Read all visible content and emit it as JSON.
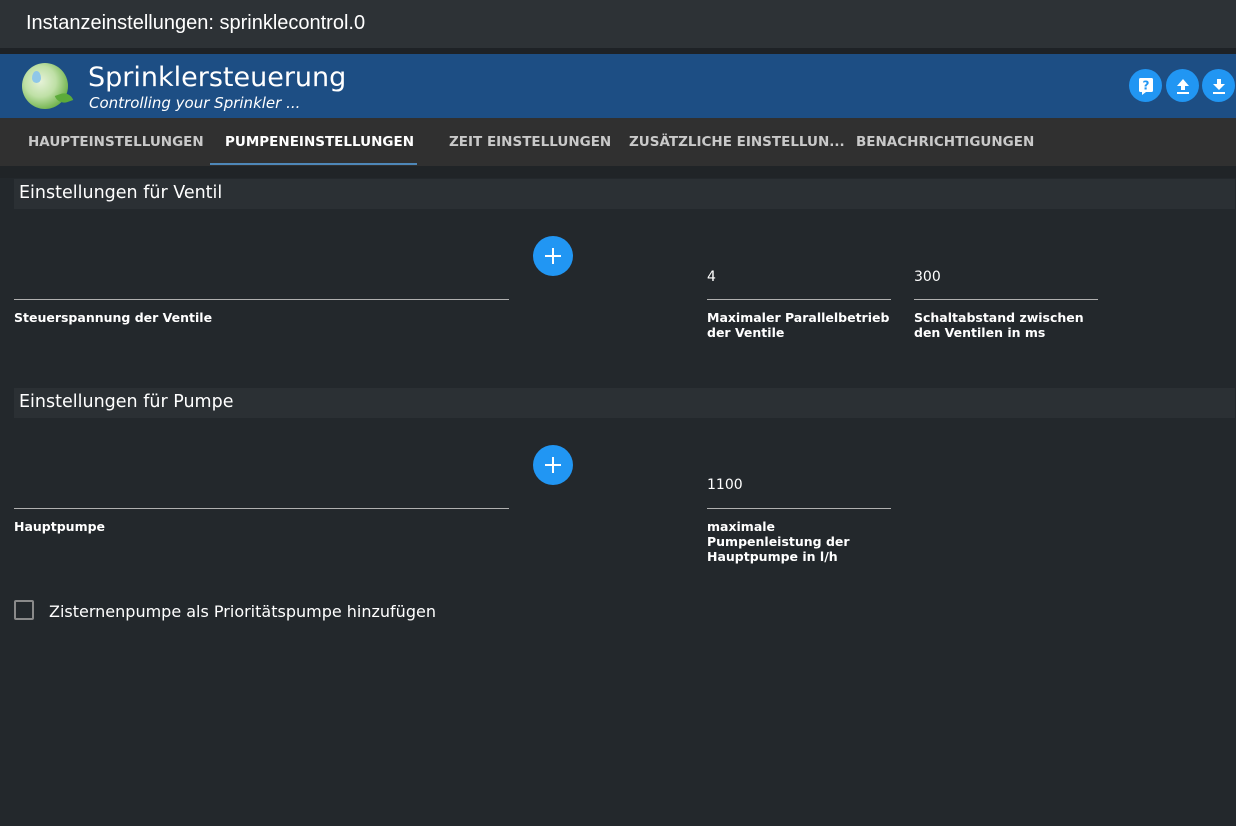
{
  "window": {
    "title": "Instanzeinstellungen: sprinklecontrol.0"
  },
  "banner": {
    "title": "Sprinklersteuerung",
    "subtitle": "Controlling your Sprinkler ...",
    "accent": "#1d4e84",
    "icons": [
      "help-icon",
      "upload-icon",
      "download-icon"
    ]
  },
  "tabs": [
    {
      "label": "HAUPTEINSTELLUNGEN"
    },
    {
      "label": "PUMPENEINSTELLUNGEN"
    },
    {
      "label": "ZEIT EINSTELLUNGEN"
    },
    {
      "label": "ZUSÄTZLICHE EINSTELLUN..."
    },
    {
      "label": "BENACHRICHTIGUNGEN"
    }
  ],
  "active_tab": "PUMPENEINSTELLUNGEN",
  "valve_section": {
    "title": "Einstellungen für Ventil",
    "control_voltage": {
      "label": "Steuerspannung der Ventile",
      "value": ""
    },
    "max_parallel": {
      "label": "Maximaler Parallelbetrieb der Ventile",
      "value": "4"
    },
    "switch_interval": {
      "label": "Schaltabstand zwischen den Ventilen in ms",
      "value": "300"
    }
  },
  "pump_section": {
    "title": "Einstellungen für Pumpe",
    "main_pump": {
      "label": "Hauptpumpe",
      "value": ""
    },
    "max_pump_output": {
      "label": "maximale Pumpenleistung der Hauptpumpe in l/h",
      "value": "1100"
    }
  },
  "cistern_checkbox": {
    "label": "Zisternenpumpe als Prioritätspumpe hinzufügen",
    "checked": false
  }
}
